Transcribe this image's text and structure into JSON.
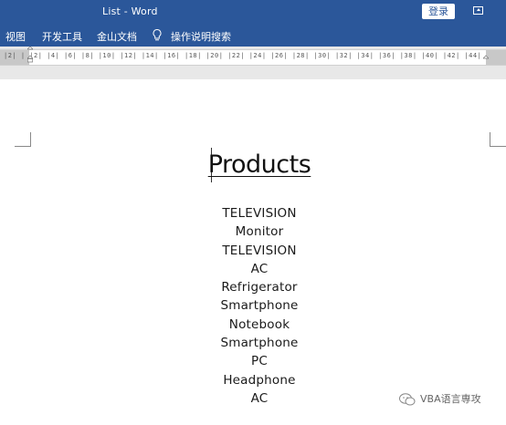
{
  "window": {
    "title": "List  -  Word",
    "login_label": "登录"
  },
  "ribbon": {
    "tabs": [
      "视图",
      "开发工具",
      "金山文档"
    ],
    "search_label": "操作说明搜索"
  },
  "ruler": {
    "labels": "|2|  |  |2|  |4|  |6|  |8|  |10|  |12|  |14|  |16|  |18|  |20|  |22|  |24|  |26|  |28|  |30|  |32|  |34|  |36|  |38|  |40|  |42|  |44|"
  },
  "document": {
    "title": "Products",
    "items": [
      "TELEVISION",
      "Monitor",
      "TELEVISION",
      "AC",
      "Refrigerator",
      "Smartphone",
      "Notebook",
      "Smartphone",
      "PC",
      "Headphone",
      "AC"
    ]
  },
  "watermark": {
    "text": "VBA语言専攻"
  }
}
